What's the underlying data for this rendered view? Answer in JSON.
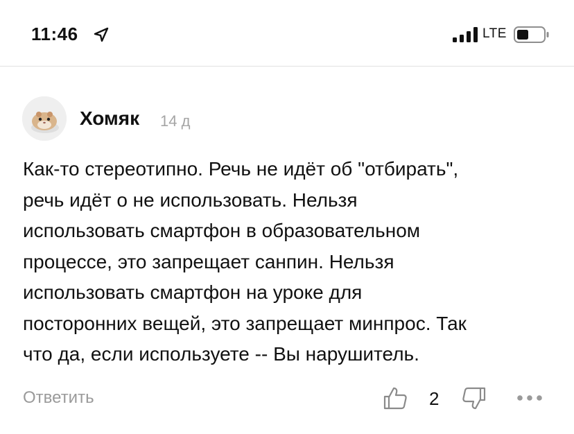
{
  "status_bar": {
    "time": "11:46",
    "network": "LTE",
    "icons": [
      "location-arrow-icon",
      "signal-icon",
      "battery-icon"
    ]
  },
  "comment": {
    "author": "Хомяк",
    "timestamp": "14 д",
    "avatar": "hamster-avatar",
    "text": "Как-то стереотипно. Речь не идёт об \"отбирать\",\nречь идёт о не использовать. Нельзя\nиспользовать смартфон в образовательном\nпроцессе, это запрещает санпин. Нельзя\nиспользовать смартфон на уроке для\nпосторонних вещей, это запрещает минпрос. Так\nчто да, если используете -- Вы нарушитель."
  },
  "actions": {
    "reply_label": "Ответить",
    "like_count": "2",
    "icons": [
      "thumbs-up-icon",
      "thumbs-down-icon",
      "more-dots-icon"
    ]
  },
  "colors": {
    "text": "#111111",
    "muted": "#9a9a9a",
    "divider": "#e2e2e2"
  }
}
